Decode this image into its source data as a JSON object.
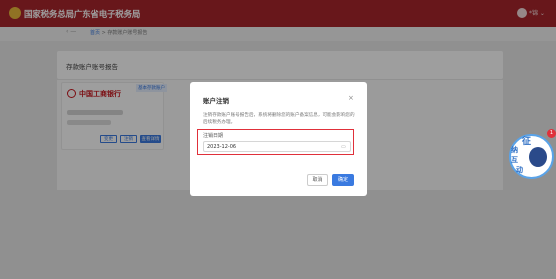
{
  "header": {
    "title": "国家税务总局广东省电子税务局",
    "user": "*锦 ⌄"
  },
  "breadcrumb": {
    "back": "‹ —",
    "home": "首页",
    "sep": " > ",
    "current": "存款账户账号报告"
  },
  "section": {
    "title": "存款账户账号报告"
  },
  "bank_card": {
    "name": "中国工商银行",
    "badge": "基本存款账户",
    "buttons": [
      "变更",
      "注销",
      "查看详情"
    ]
  },
  "modal": {
    "title": "账户注销",
    "close": "×",
    "description": "注销存款账户账号报告后，系统将删除您的账户备案信息，可能会影响您的后续税务办理。",
    "date_label": "注销日期",
    "date_value": "2023-12-06",
    "calendar_icon": "calendar-icon",
    "cancel": "取消",
    "confirm": "确定"
  },
  "float_widget": {
    "char1": "征",
    "char2": "纳",
    "char3": "互",
    "char4": "动",
    "badge": "1"
  },
  "colors": {
    "header": "#a8262d",
    "primary": "#3a7ae0",
    "highlight": "#e0303a"
  }
}
